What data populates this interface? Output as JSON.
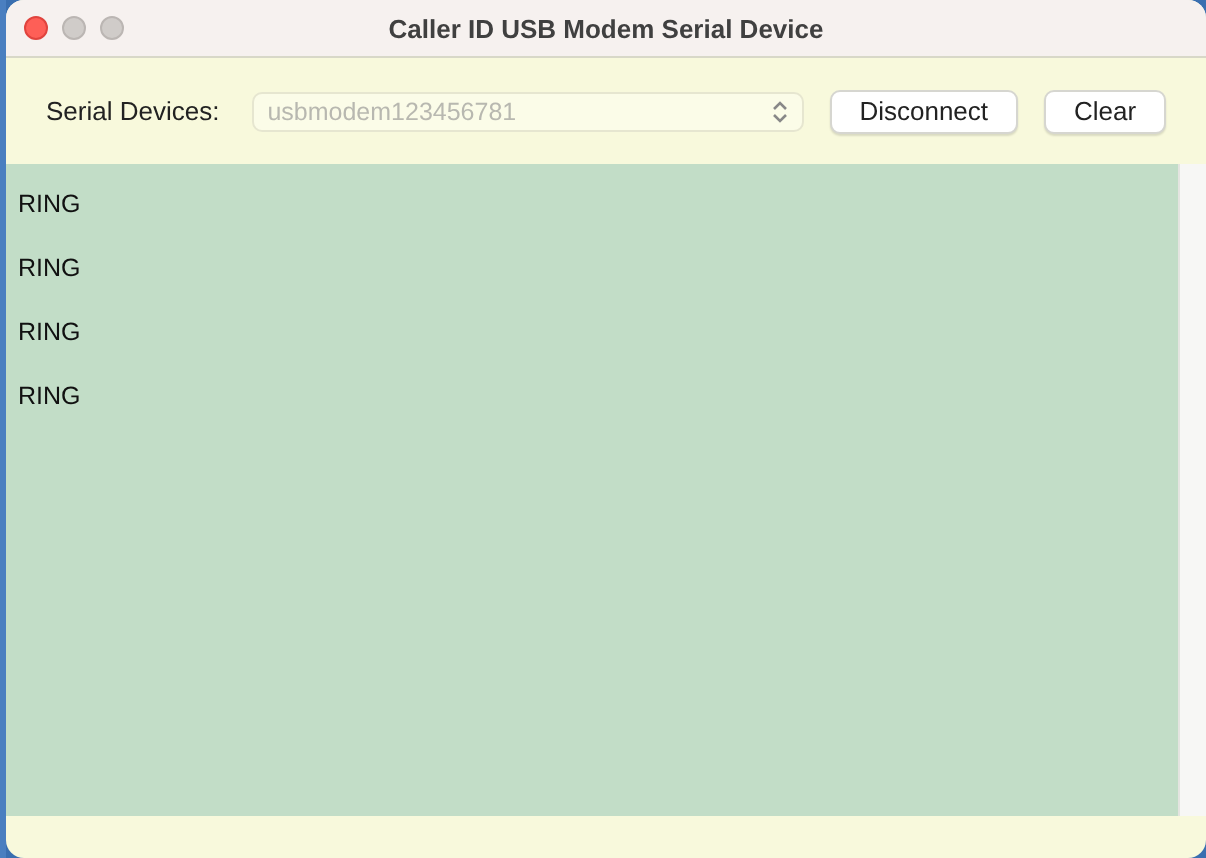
{
  "window": {
    "title": "Caller ID USB Modem Serial Device"
  },
  "toolbar": {
    "label": "Serial Devices:",
    "device_select": {
      "value": "usbmodem123456781",
      "disabled": true
    },
    "buttons": [
      {
        "label": "Disconnect"
      },
      {
        "label": "Clear"
      }
    ]
  },
  "log": {
    "lines": [
      "RING",
      "RING",
      "RING",
      "RING"
    ]
  }
}
